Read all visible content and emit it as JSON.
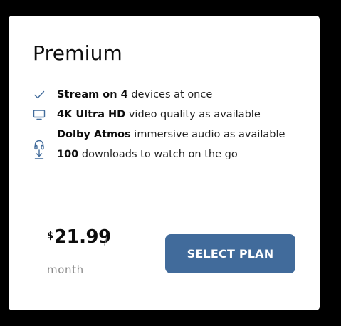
{
  "plan": {
    "name": "Premium",
    "features": [
      {
        "icon": "check-icon",
        "bold": "Stream on 4",
        "text": " devices at once"
      },
      {
        "icon": "monitor-icon",
        "bold": "4K Ultra HD",
        "text": " video quality as available"
      },
      {
        "icon": "headphones-icon",
        "bold": "Dolby Atmos",
        "text": " immersive audio as available"
      },
      {
        "icon": "download-icon",
        "bold": "100",
        "text": " downloads to watch on the go"
      }
    ],
    "price": {
      "currency": "$",
      "amount": "21.99",
      "separator": "/",
      "period": "month"
    },
    "cta_label": "SELECT PLAN"
  },
  "colors": {
    "page_background": "#000000",
    "card_background": "#ffffff",
    "button_background": "#416b9b",
    "icon_color": "#416b9b"
  }
}
